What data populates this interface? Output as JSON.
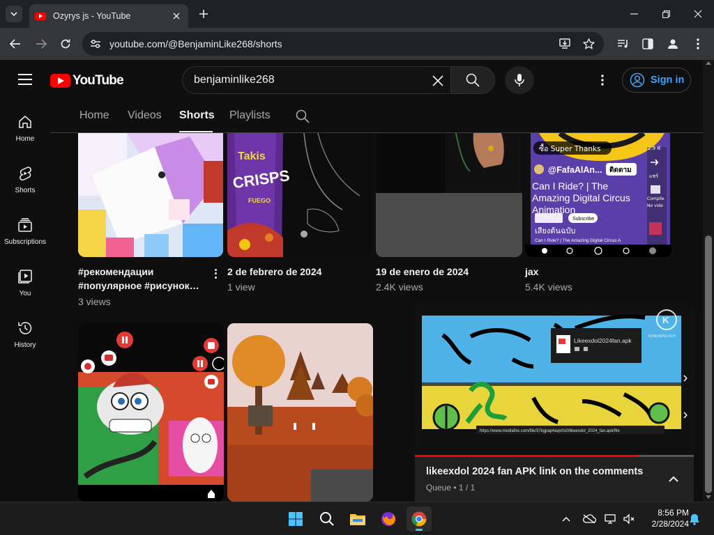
{
  "browser": {
    "tab_title": "Ozyrys js - YouTube",
    "url": "youtube.com/@BenjaminLike268/shorts"
  },
  "youtube": {
    "logo_text": "YouTube",
    "search_query": "benjaminlike268",
    "signin_label": "Sign in"
  },
  "guide": {
    "items": [
      {
        "label": "Home",
        "icon": "home-icon"
      },
      {
        "label": "Shorts",
        "icon": "shorts-icon"
      },
      {
        "label": "Subscriptions",
        "icon": "subscriptions-icon"
      },
      {
        "label": "You",
        "icon": "you-icon"
      },
      {
        "label": "History",
        "icon": "history-icon"
      }
    ]
  },
  "channel_tabs": {
    "items": [
      "Home",
      "Videos",
      "Shorts",
      "Playlists"
    ],
    "active": "Shorts"
  },
  "shorts": [
    {
      "title_line1": "#рекомендации",
      "title_line2": "#популярное #рисунок…",
      "views": "3 views"
    },
    {
      "title_line1": "2 de febrero de 2024",
      "title_line2": "",
      "views": "1 view"
    },
    {
      "title_line1": "19 de enero de 2024",
      "title_line2": "",
      "views": "2.4K views"
    },
    {
      "title_line1": "jax",
      "title_line2": "",
      "views": "5.4K views"
    }
  ],
  "thumb_text": {
    "takis_line1": "Takis",
    "takis_line2": "CRISPS",
    "takis_line3": "FUEGO",
    "super_thanks": "ซื้อ Super Thanks",
    "channel_name": "@FafaAlAn...",
    "follow_btn": "ติดตาม",
    "video_title": "Can I Ride? | The Amazing Digital Circus Animation",
    "thai_caption": "เสียงต้นฉบับ",
    "right_rail_1": "2.9 พั",
    "right_rail_2": "แชร์",
    "right_rail_3": "Compile",
    "right_rail_4": "No vide",
    "subscribe_chip": "Subscribe",
    "bottom_caption": "Can I Ride? | The Amazing Digital Circus A"
  },
  "miniplayer": {
    "title": "likeexdol 2024 fan APK link on the comments",
    "queue": "Queue • 1 / 1",
    "progress": 0.8,
    "file_name": "Likeexdol2024fan.apk",
    "link_text": "https://www.mediafire.com/file/37kgpap4aqv0s0/likeexdol_2024_fan.apk/file",
    "watermark": "KINEMASTER"
  },
  "taskbar": {
    "time": "8:56 PM",
    "date": "2/28/2024"
  },
  "colors": {
    "accent_red": "#ff0000",
    "link_blue": "#3ea6ff",
    "background": "#0f0f0f"
  }
}
